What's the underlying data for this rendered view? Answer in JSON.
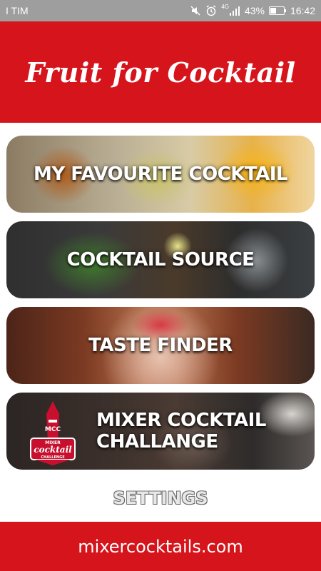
{
  "status_bar": {
    "carrier": "I TIM",
    "network_type": "4G",
    "battery_percent": "43%",
    "time": "16:42",
    "icons": [
      "mute-icon",
      "alarm-icon",
      "signal-icon",
      "battery-icon"
    ]
  },
  "header": {
    "title": "Fruit for Cocktail",
    "background_color": "#d6141c"
  },
  "menu": {
    "items": [
      {
        "label": "MY FAVOURITE COCKTAIL"
      },
      {
        "label": "COCKTAIL SOURCE"
      },
      {
        "label": "TASTE FINDER"
      },
      {
        "label": "MIXER COCKTAIL\nCHALLANGE"
      }
    ],
    "badge": {
      "top": "MCC",
      "mid": "MIXER",
      "main": "cocktail",
      "sub": "CHALLENGE"
    }
  },
  "settings": {
    "label": "SETTINGS"
  },
  "footer": {
    "label": "mixercocktails.com",
    "background_color": "#d6141c"
  }
}
